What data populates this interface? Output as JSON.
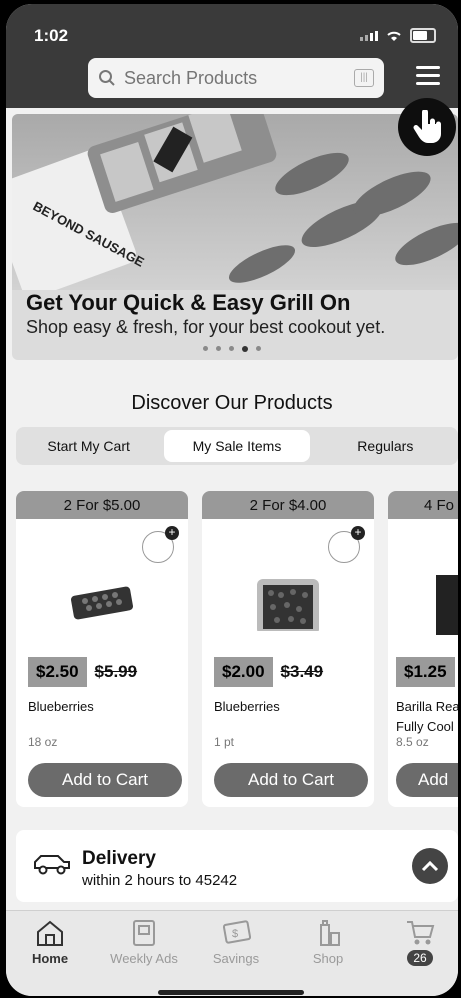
{
  "status": {
    "time": "1:02"
  },
  "search": {
    "placeholder": "Search Products"
  },
  "banner": {
    "title": "Get Your Quick & Easy Grill On",
    "subtitle": "Shop easy & fresh, for your best cookout yet.",
    "product_text": "BEYOND SAUSAGE",
    "slide_count": 5,
    "active_slide": 4
  },
  "discover": {
    "title": "Discover Our Products",
    "tabs": [
      {
        "label": "Start My Cart",
        "active": false
      },
      {
        "label": "My Sale Items",
        "active": true
      },
      {
        "label": "Regulars",
        "active": false
      }
    ]
  },
  "products": [
    {
      "deal": "2 For $5.00",
      "price": "$2.50",
      "regular_price": "$5.99",
      "name": "Blueberries",
      "size": "18 oz",
      "button": "Add to Cart"
    },
    {
      "deal": "2 For $4.00",
      "price": "$2.00",
      "regular_price": "$3.49",
      "name": "Blueberries",
      "size": "1 pt",
      "button": "Add to Cart"
    },
    {
      "deal": "4 Fo",
      "price": "$1.25",
      "regular_price": "",
      "name": "Barilla Rea",
      "name2": "Fully Cool",
      "size": "8.5 oz",
      "button": "Add"
    }
  ],
  "delivery": {
    "title": "Delivery",
    "subtitle": "within 2 hours to 45242"
  },
  "nav": {
    "items": [
      {
        "label": "Home",
        "icon": "home-icon",
        "active": true
      },
      {
        "label": "Weekly Ads",
        "icon": "weekly-ads-icon",
        "active": false
      },
      {
        "label": "Savings",
        "icon": "savings-icon",
        "active": false
      },
      {
        "label": "Shop",
        "icon": "shop-icon",
        "active": false
      }
    ],
    "cart_count": "26"
  },
  "colors": {
    "header": "#3a3a3a",
    "button": "#6b6b6b",
    "deal_band": "#999999"
  }
}
